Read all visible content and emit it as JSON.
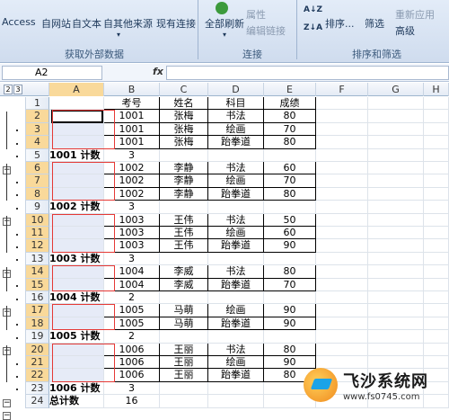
{
  "ribbon": {
    "external_data": {
      "access": "Access",
      "web": "自网站",
      "text": "自文本",
      "other": "自其他来源",
      "label": "获取外部数据"
    },
    "existing_conn": "现有连接",
    "connections": {
      "refresh_all": "全部刷新",
      "properties": "属性",
      "edit_links": "编辑链接",
      "label": "连接"
    },
    "sort_filter": {
      "sort": "排序...",
      "filter": "筛选",
      "reapply": "重新应用",
      "advanced": "高级",
      "label": "排序和筛选"
    }
  },
  "formula_bar": {
    "name_box": "A2",
    "fx": "fx",
    "value": ""
  },
  "sheet": {
    "outline_levels": [
      "2",
      "3"
    ],
    "columns": [
      "A",
      "B",
      "C",
      "D",
      "E",
      "F",
      "G",
      "H"
    ],
    "rows": [
      {
        "n": "1",
        "a": "",
        "b": "考号",
        "c": "姓名",
        "d": "科目",
        "e": "成绩"
      },
      {
        "n": "2",
        "a": "",
        "b": "1001",
        "c": "张梅",
        "d": "书法",
        "e": "80"
      },
      {
        "n": "3",
        "a": "",
        "b": "1001",
        "c": "张梅",
        "d": "绘画",
        "e": "70"
      },
      {
        "n": "4",
        "a": "",
        "b": "1001",
        "c": "张梅",
        "d": "跆拳道",
        "e": "80"
      },
      {
        "n": "5",
        "a": "1001 计数",
        "b": "3",
        "c": "",
        "d": "",
        "e": ""
      },
      {
        "n": "6",
        "a": "",
        "b": "1002",
        "c": "李静",
        "d": "书法",
        "e": "60"
      },
      {
        "n": "7",
        "a": "",
        "b": "1002",
        "c": "李静",
        "d": "绘画",
        "e": "70"
      },
      {
        "n": "8",
        "a": "",
        "b": "1002",
        "c": "李静",
        "d": "跆拳道",
        "e": "80"
      },
      {
        "n": "9",
        "a": "1002 计数",
        "b": "3",
        "c": "",
        "d": "",
        "e": ""
      },
      {
        "n": "10",
        "a": "",
        "b": "1003",
        "c": "王伟",
        "d": "书法",
        "e": "50"
      },
      {
        "n": "11",
        "a": "",
        "b": "1003",
        "c": "王伟",
        "d": "绘画",
        "e": "60"
      },
      {
        "n": "12",
        "a": "",
        "b": "1003",
        "c": "王伟",
        "d": "跆拳道",
        "e": "90"
      },
      {
        "n": "13",
        "a": "1003 计数",
        "b": "3",
        "c": "",
        "d": "",
        "e": ""
      },
      {
        "n": "14",
        "a": "",
        "b": "1004",
        "c": "李威",
        "d": "书法",
        "e": "80"
      },
      {
        "n": "15",
        "a": "",
        "b": "1004",
        "c": "李威",
        "d": "跆拳道",
        "e": "70"
      },
      {
        "n": "16",
        "a": "1004 计数",
        "b": "2",
        "c": "",
        "d": "",
        "e": ""
      },
      {
        "n": "17",
        "a": "",
        "b": "1005",
        "c": "马萌",
        "d": "绘画",
        "e": "90"
      },
      {
        "n": "18",
        "a": "",
        "b": "1005",
        "c": "马萌",
        "d": "跆拳道",
        "e": "90"
      },
      {
        "n": "19",
        "a": "1005 计数",
        "b": "2",
        "c": "",
        "d": "",
        "e": ""
      },
      {
        "n": "20",
        "a": "",
        "b": "1006",
        "c": "王丽",
        "d": "书法",
        "e": "80"
      },
      {
        "n": "21",
        "a": "",
        "b": "1006",
        "c": "王丽",
        "d": "绘画",
        "e": "90"
      },
      {
        "n": "22",
        "a": "",
        "b": "1006",
        "c": "王丽",
        "d": "跆拳道",
        "e": "80"
      },
      {
        "n": "23",
        "a": "1006 计数",
        "b": "3",
        "c": "",
        "d": "",
        "e": ""
      },
      {
        "n": "24",
        "a": "总计数",
        "b": "16",
        "c": "",
        "d": "",
        "e": ""
      }
    ]
  },
  "watermark": {
    "title": "飞沙系统网",
    "url": "www.fs0745.com"
  }
}
